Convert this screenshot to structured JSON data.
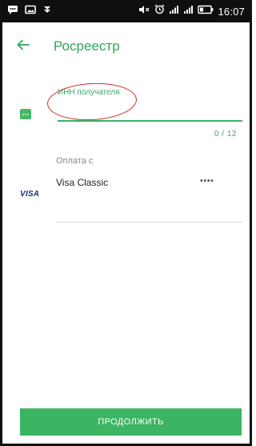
{
  "status_bar": {
    "time": "16:07",
    "icons": [
      "message-icon",
      "image-icon",
      "download-icon",
      "mute-icon",
      "alarm-icon",
      "signal-icon",
      "signal-icon",
      "battery-icon"
    ]
  },
  "header": {
    "title": "Росреестр",
    "back_icon": "arrow-left-icon"
  },
  "inn_field": {
    "label": "ИНН получателя",
    "value": "",
    "counter": "0 / 12"
  },
  "payment": {
    "label": "Оплата с",
    "card_brand": "VISA",
    "card_name": "Visa Classic",
    "card_mask": "••••"
  },
  "continue_button": {
    "label": "ПРОДОЛЖИТЬ"
  },
  "colors": {
    "accent": "#3cb563",
    "title": "#2fa55a",
    "highlight_circle": "#d22a2a",
    "status_bar": "#0f0f0f"
  }
}
